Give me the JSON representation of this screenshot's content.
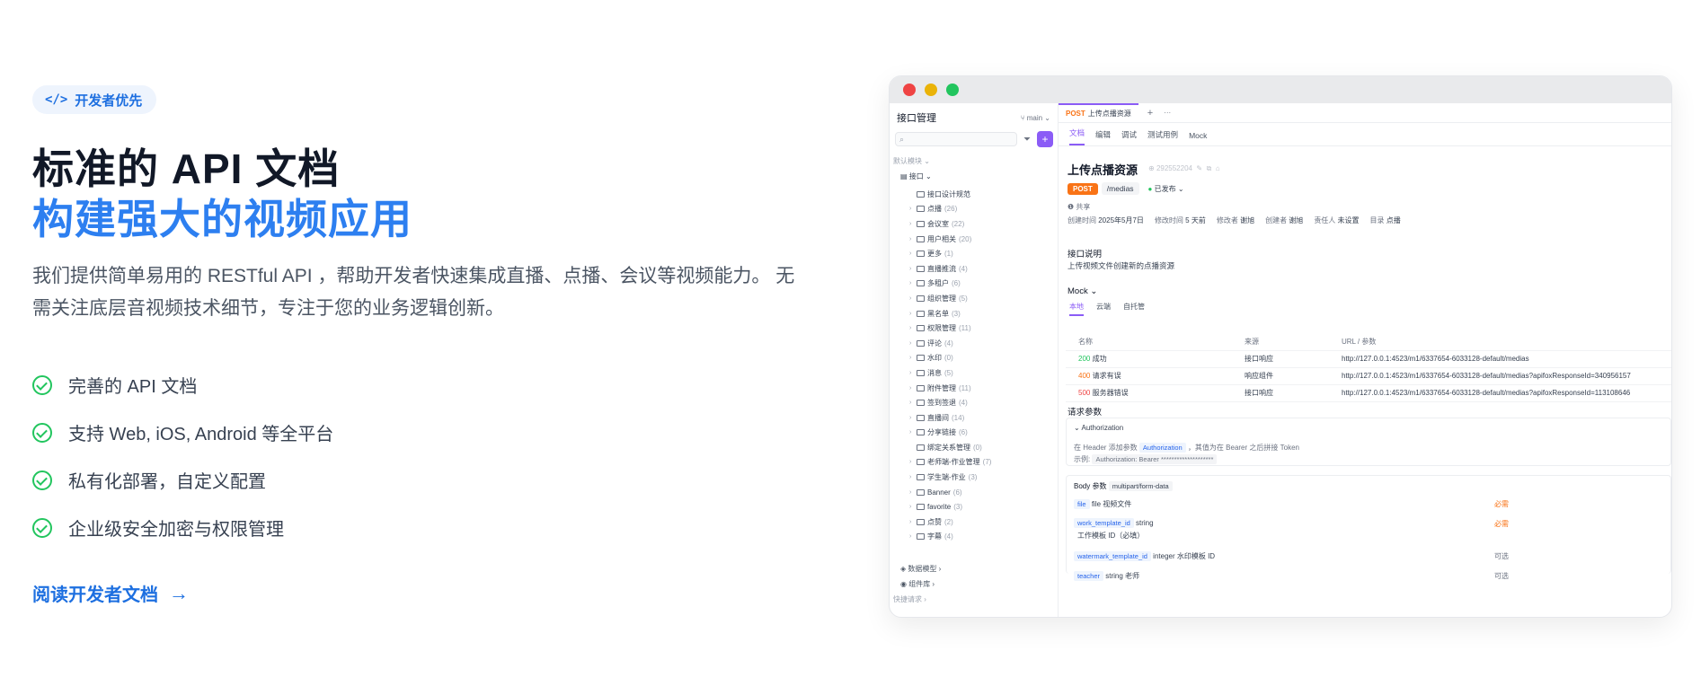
{
  "hero": {
    "badge": "开发者优先",
    "badge_icon": "</>",
    "title_line1": "标准的 API 文档",
    "title_line2": "构建强大的视频应用",
    "description": "我们提供简单易用的 RESTful API ，帮助开发者快速集成直播、点播、会议等视频能力。 无需关注底层音视频技术细节，专注于您的业务逻辑创新。",
    "features": [
      "完善的 API 文档",
      "支持 Web, iOS, Android 等全平台",
      "私有化部署，自定义配置",
      "企业级安全加密与权限管理"
    ],
    "cta": "阅读开发者文档",
    "cta_arrow": "→"
  },
  "colors": {
    "accent": "#2d7ff0",
    "check": "#22c55e",
    "brand_purple": "#8b5cf6",
    "post": "#f97316",
    "dot_red": "#ef4444",
    "dot_yellow": "#eab308",
    "dot_green": "#22c55e"
  },
  "app": {
    "sidebar": {
      "title": "接口管理",
      "branch": "main",
      "default_module": "默认模块",
      "root": "接口",
      "items": [
        {
          "label": "接口设计规范",
          "count": "",
          "caret": ""
        },
        {
          "label": "点播",
          "count": "(26)",
          "caret": "›"
        },
        {
          "label": "会议室",
          "count": "(22)",
          "caret": "›"
        },
        {
          "label": "用户相关",
          "count": "(20)",
          "caret": "›"
        },
        {
          "label": "更多",
          "count": "(1)",
          "caret": "›"
        },
        {
          "label": "直播推流",
          "count": "(4)",
          "caret": "›"
        },
        {
          "label": "多租户",
          "count": "(6)",
          "caret": "›"
        },
        {
          "label": "组织管理",
          "count": "(5)",
          "caret": "›"
        },
        {
          "label": "黑名单",
          "count": "(3)",
          "caret": "›"
        },
        {
          "label": "权限管理",
          "count": "(11)",
          "caret": "›"
        },
        {
          "label": "评论",
          "count": "(4)",
          "caret": "›"
        },
        {
          "label": "水印",
          "count": "(0)",
          "caret": "›"
        },
        {
          "label": "消息",
          "count": "(5)",
          "caret": "›"
        },
        {
          "label": "附件管理",
          "count": "(11)",
          "caret": "›"
        },
        {
          "label": "签到签退",
          "count": "(4)",
          "caret": "›"
        },
        {
          "label": "直播间",
          "count": "(14)",
          "caret": "›"
        },
        {
          "label": "分享链接",
          "count": "(6)",
          "caret": "›"
        },
        {
          "label": "绑定关系管理",
          "count": "(0)",
          "caret": ""
        },
        {
          "label": "老师端-作业管理",
          "count": "(7)",
          "caret": "›"
        },
        {
          "label": "学生端-作业",
          "count": "(3)",
          "caret": "›"
        },
        {
          "label": "Banner",
          "count": "(6)",
          "caret": "›"
        },
        {
          "label": "favorite",
          "count": "(3)",
          "caret": "›"
        },
        {
          "label": "点赞",
          "count": "(2)",
          "caret": "›"
        },
        {
          "label": "字幕",
          "count": "(4)",
          "caret": "›"
        }
      ],
      "data_models": "数据模型",
      "components": "组件库",
      "quick_requests": "快捷请求"
    },
    "tab": {
      "method": "POST",
      "name": "上传点播资源"
    },
    "subtabs": [
      "文档",
      "编辑",
      "调试",
      "测试用例",
      "Mock"
    ],
    "endpoint": {
      "title": "上传点播资源",
      "id": "292552204",
      "method": "POST",
      "path": "/medias",
      "status": "已发布",
      "share": "共享",
      "meta": [
        {
          "k": "创建时间",
          "v": "2025年5月7日"
        },
        {
          "k": "修改时间",
          "v": "5 天前"
        },
        {
          "k": "修改者",
          "v": "谢旭"
        },
        {
          "k": "创建者",
          "v": "谢旭"
        },
        {
          "k": "责任人",
          "v": "未设置"
        },
        {
          "k": "目录",
          "v": "点播"
        }
      ],
      "desc_title": "接口说明",
      "desc": "上传视频文件创建新的点播资源"
    },
    "mock": {
      "title": "Mock",
      "tabs": [
        "本地",
        "云端",
        "自托管"
      ],
      "headers": [
        "名称",
        "来源",
        "URL / 参数"
      ],
      "rows": [
        {
          "code": "200",
          "name": "成功",
          "source": "接口响应",
          "url": "http://127.0.0.1:4523/m1/6337654-6033128-default/medias"
        },
        {
          "code": "400",
          "name": "请求有误",
          "source": "响应组件",
          "url": "http://127.0.0.1:4523/m1/6337654-6033128-default/medias?apifoxResponseId=340956157"
        },
        {
          "code": "500",
          "name": "服务器错误",
          "source": "接口响应",
          "url": "http://127.0.0.1:4523/m1/6337654-6033128-default/medias?apifoxResponseId=113108646"
        }
      ]
    },
    "params": {
      "title": "请求参数",
      "auth_title": "Authorization",
      "auth_desc_pre": "在 Header 添加参数",
      "auth_param": "Authorization",
      "auth_desc_post": "，其值为在 Bearer 之后拼接 Token",
      "example_label": "示例:",
      "example_value": "Authorization: Bearer ********************",
      "body_title": "Body 参数",
      "body_type": "multipart/form-data",
      "body": [
        {
          "name": "file",
          "type": "file",
          "desc": "视频文件",
          "req": "必需"
        },
        {
          "name": "work_template_id",
          "type": "string",
          "desc": "",
          "req": "必需",
          "sub": "工作模板 ID（必填）"
        },
        {
          "name": "watermark_template_id",
          "type": "integer",
          "desc": "水印模板 ID",
          "req": "可选"
        },
        {
          "name": "teacher",
          "type": "string",
          "desc": "老师",
          "req": "可选"
        }
      ]
    }
  }
}
